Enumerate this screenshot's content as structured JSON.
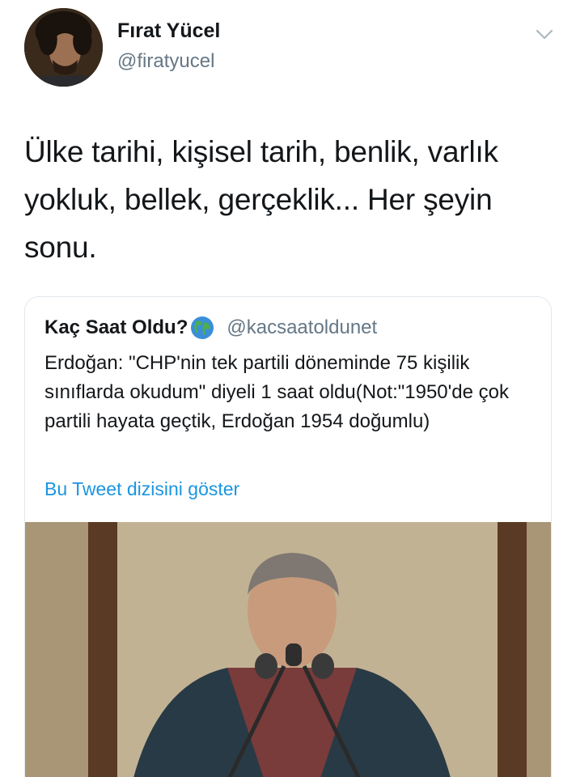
{
  "tweet": {
    "author_name": "Fırat Yücel",
    "author_handle": "@firatyucel",
    "text": "Ülke tarihi, kişisel tarih, benlik, varlık yokluk, bellek, gerçeklik... Her şeyin sonu."
  },
  "quoted": {
    "name": "Kaç Saat Oldu?",
    "handle": "@kacsaatoldunet",
    "text": "Erdoğan: \"CHP'nin tek partili döneminde 75 kişilik sınıflarda okudum\" diyeli 1 saat oldu(Not:\"1950'de çok partili hayata geçtik, Erdoğan 1954 doğumlu)",
    "thread_link": "Bu Tweet dizisini göster"
  },
  "icons": {
    "caret": "chevron-down-icon",
    "globe": "globe-icon"
  },
  "colors": {
    "primary_text": "#14171a",
    "secondary_text": "#657786",
    "link": "#1b95e0",
    "border": "#e1e8ed"
  }
}
